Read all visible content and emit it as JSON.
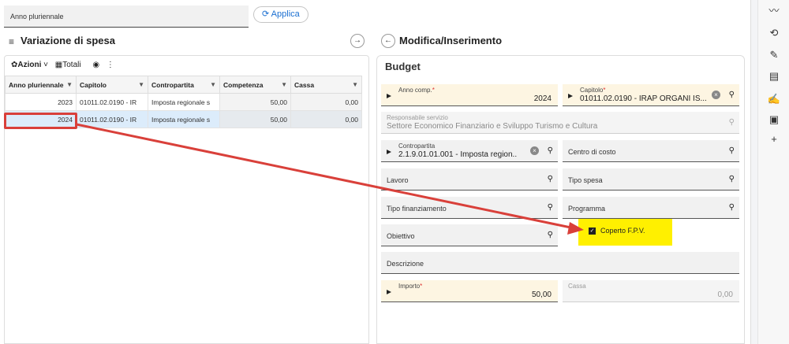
{
  "filter": {
    "label": "Anno pluriennale"
  },
  "apply_button": {
    "label": "Applica"
  },
  "left_panel": {
    "title": "Variazione di spesa",
    "toolbar": {
      "actions": "Azioni",
      "totals": "Totali"
    },
    "columns": [
      "Anno pluriennale",
      "Capitolo",
      "Contropartita",
      "Competenza",
      "Cassa"
    ],
    "rows": [
      [
        "2023",
        "01011.02.0190 - IR",
        "Imposta regionale s",
        "50,00",
        "0,00"
      ],
      [
        "2024",
        "01011.02.0190 - IR",
        "Imposta regionale s",
        "50,00",
        "0,00"
      ]
    ]
  },
  "right_panel": {
    "title": "Modifica/Inserimento",
    "section": "Budget",
    "fields": {
      "anno_comp": {
        "label": "Anno comp.",
        "value": "2024"
      },
      "capitolo": {
        "label": "Capitolo",
        "value": "01011.02.0190 - IRAP ORGANI IS..."
      },
      "responsabile": {
        "label": "Responsabile servizio",
        "value": "Settore Economico Finanziario e Sviluppo Turismo e Cultura"
      },
      "contropartita": {
        "label": "Contropartita",
        "value": "2.1.9.01.01.001 - Imposta region..."
      },
      "centro_costo": {
        "label": "Centro di costo"
      },
      "lavoro": {
        "label": "Lavoro"
      },
      "tipo_spesa": {
        "label": "Tipo spesa"
      },
      "tipo_finanziamento": {
        "label": "Tipo finanziamento"
      },
      "programma": {
        "label": "Programma"
      },
      "obiettivo": {
        "label": "Obiettivo"
      },
      "coperto_fpv": {
        "label": "Coperto F.P.V.",
        "checked": true
      },
      "descrizione": {
        "label": "Descrizione"
      },
      "importo": {
        "label": "Importo",
        "value": "50,00"
      },
      "cassa": {
        "label": "Cassa",
        "value": "0,00"
      }
    }
  },
  "annotation_color": "#d9403a",
  "highlight_color": "#fff000"
}
